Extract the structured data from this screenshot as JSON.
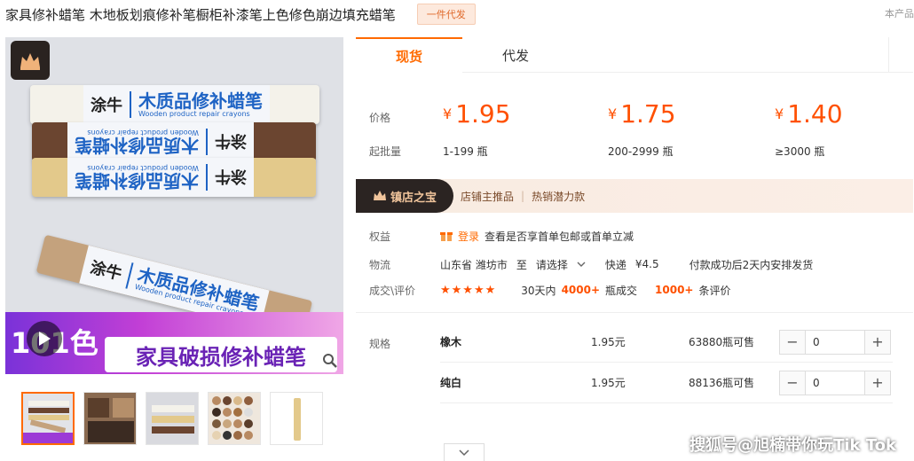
{
  "product": {
    "title": "家具修补蜡笔 木地板划痕修补笔橱柜补漆笔上色修色崩边填充蜡笔",
    "agent_badge": "一件代发",
    "top_right_text": "本产品"
  },
  "gallery": {
    "brand_text": "涂牛",
    "crayon_label": "木质品修补蜡笔",
    "crayon_sub": "Wooden product repair crayons",
    "color_count": "101色",
    "slogan": "家具破损修补蜡笔",
    "thumbnail_count": 5
  },
  "tabs": [
    {
      "label": "现货",
      "active": true
    },
    {
      "label": "代发",
      "active": false
    }
  ],
  "pricing": {
    "price_label": "价格",
    "moq_label": "起批量",
    "currency": "¥",
    "tiers": [
      {
        "price": "1.95",
        "range": "1-199 瓶"
      },
      {
        "price": "1.75",
        "range": "200-2999 瓶"
      },
      {
        "price": "1.40",
        "range": "≥3000 瓶"
      }
    ],
    "accent_color": "#ff5000"
  },
  "treasure": {
    "tag": "镇店之宝",
    "items": [
      "店铺主推品",
      "热销潜力款"
    ]
  },
  "info": {
    "benefits_label": "权益",
    "login_text": "登录",
    "benefits_text": "查看是否享首单包邮或首单立减",
    "logistics_label": "物流",
    "origin": "山东省 潍坊市",
    "to": "至",
    "destination": "请选择",
    "shipping_method": "快递",
    "shipping_price": "¥4.5",
    "shipping_note": "付款成功后2天内安排发货",
    "reviews_label": "成交\\评价",
    "stars": "★★★★★",
    "days_text": "30天内",
    "sold_count": "4000+",
    "sold_unit": "瓶成交",
    "review_count": "1000+",
    "review_unit": "条评价"
  },
  "spec": {
    "label": "规格",
    "rows": [
      {
        "name": "橡木",
        "price": "1.95元",
        "stock": "63880瓶可售",
        "qty": "0"
      },
      {
        "name": "纯白",
        "price": "1.95元",
        "stock": "88136瓶可售",
        "qty": "0"
      }
    ]
  },
  "watermark": "搜狐号@旭楠带你玩Tik Tok"
}
